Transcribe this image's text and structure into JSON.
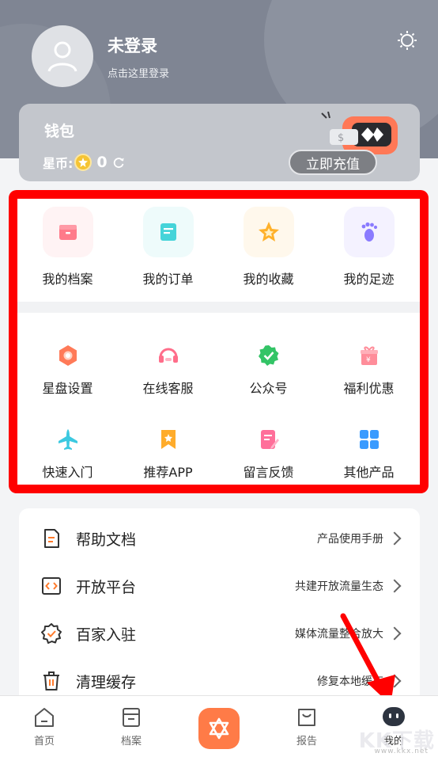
{
  "profile": {
    "name": "未登录",
    "login_hint": "点击这里登录"
  },
  "wallet": {
    "title": "钱包",
    "coin_label": "星币:",
    "coin_count": "0",
    "recharge_label": "立即充值"
  },
  "grid_top": [
    {
      "label": "我的档案",
      "icon": "archive-icon",
      "color": "#ff7a8a"
    },
    {
      "label": "我的订单",
      "icon": "order-icon",
      "color": "#45d4d9"
    },
    {
      "label": "我的收藏",
      "icon": "star-icon",
      "color": "#ffb12b"
    },
    {
      "label": "我的足迹",
      "icon": "footprint-icon",
      "color": "#8a7bff"
    }
  ],
  "grid_middle": [
    {
      "label": "星盘设置",
      "icon": "astrolabe-icon",
      "color": "#ff7a58"
    },
    {
      "label": "在线客服",
      "icon": "headset-icon",
      "color": "#ff6d8a"
    },
    {
      "label": "公众号",
      "icon": "verified-icon",
      "color": "#33c466"
    },
    {
      "label": "福利优惠",
      "icon": "gift-icon",
      "color": "#ff8d9a"
    }
  ],
  "grid_bottom": [
    {
      "label": "快速入门",
      "icon": "plane-icon",
      "color": "#3cc9e0"
    },
    {
      "label": "推荐APP",
      "icon": "bookmark-icon",
      "color": "#ffac2b"
    },
    {
      "label": "留言反馈",
      "icon": "feedback-icon",
      "color": "#ff6f9a"
    },
    {
      "label": "其他产品",
      "icon": "apps-icon",
      "color": "#3a9bff"
    }
  ],
  "menu": [
    {
      "label": "帮助文档",
      "note": "产品使用手册",
      "icon": "document-icon"
    },
    {
      "label": "开放平台",
      "note": "共建开放流量生态",
      "icon": "code-icon"
    },
    {
      "label": "百家入驻",
      "note": "媒体流量整合放大",
      "icon": "badge-icon"
    },
    {
      "label": "清理缓存",
      "note": "修复本地缓存",
      "icon": "trash-icon"
    }
  ],
  "tabs": [
    {
      "label": "首页",
      "icon": "home-icon"
    },
    {
      "label": "档案",
      "icon": "folder-icon"
    },
    {
      "label": "报告",
      "icon": "report-icon"
    },
    {
      "label": "我的",
      "icon": "profile-icon"
    }
  ],
  "watermark": {
    "text": "KK下载",
    "url_text": "www.kkx.net"
  }
}
